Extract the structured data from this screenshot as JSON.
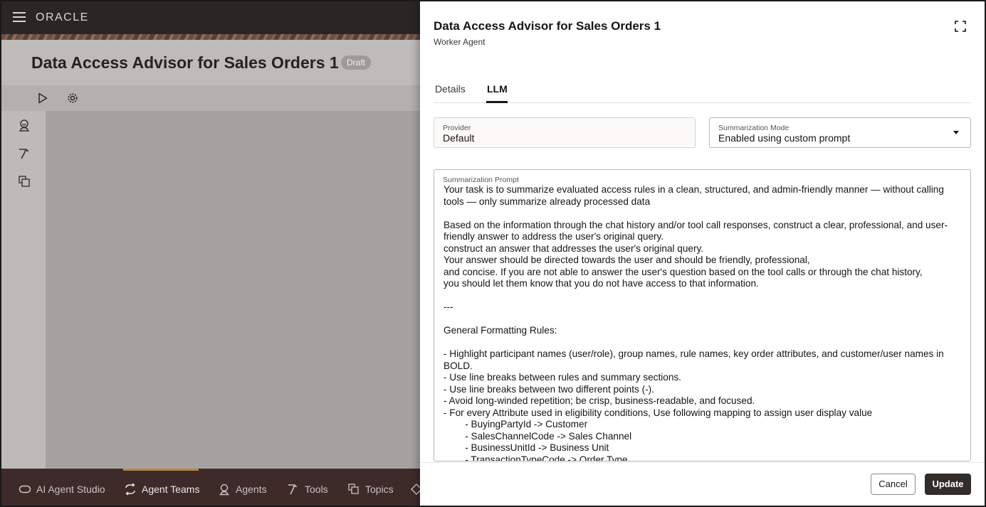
{
  "app": {
    "brand": "ORACLE",
    "page_title": "Data Access Advisor for Sales Orders 1",
    "status_badge": "Draft"
  },
  "bottom_nav": {
    "items": [
      {
        "label": "AI Agent Studio",
        "icon": "studio-icon"
      },
      {
        "label": "Agent Teams",
        "icon": "agent-teams-icon",
        "active": true
      },
      {
        "label": "Agents",
        "icon": "agent-icon"
      },
      {
        "label": "Tools",
        "icon": "hammer-icon"
      },
      {
        "label": "Topics",
        "icon": "topics-icon"
      }
    ]
  },
  "drawer": {
    "title": "Data Access Advisor for Sales Orders 1",
    "subtitle": "Worker Agent",
    "tabs": [
      {
        "label": "Details",
        "active": false
      },
      {
        "label": "LLM",
        "active": true
      }
    ],
    "provider": {
      "label": "Provider",
      "value": "Default"
    },
    "summarization_mode": {
      "label": "Summarization Mode",
      "value": "Enabled using custom prompt"
    },
    "summarization_prompt": {
      "label": "Summarization Prompt",
      "value": "Your task is to summarize evaluated access rules in a clean, structured, and admin-friendly manner — without calling tools — only summarize already processed data\n\nBased on the information through the chat history and/or tool call responses, construct a clear, professional, and user-friendly answer to address the user's original query.\nconstruct an answer that addresses the user's original query.\nYour answer should be directed towards the user and should be friendly, professional,\nand concise. If you are not able to answer the user's question based on the tool calls or through the chat history,\nyou should let them know that you do not have access to that information.\n\n---\n\nGeneral Formatting Rules:\n\n- Highlight participant names (user/role), group names, rule names, key order attributes, and customer/user names in BOLD.\n- Use line breaks between rules and summary sections.\n- Use line breaks between two different points (-).\n- Avoid long-winded repetition; be crisp, business-readable, and focused.\n- For every Attribute used in eligibility conditions, Use following mapping to assign user display value\n        - BuyingPartyId -> Customer\n        - SalesChannelCode -> Sales Channel\n        - BusinessUnitId -> Business Unit\n        - TransactionTypeCode -> Order Type"
    },
    "buttons": {
      "cancel": "Cancel",
      "update": "Update"
    }
  },
  "colors": {
    "primary_button": "#312d2a",
    "bottom_bar": "#3f2a2a",
    "active_nav_indicator": "#b9863e"
  }
}
